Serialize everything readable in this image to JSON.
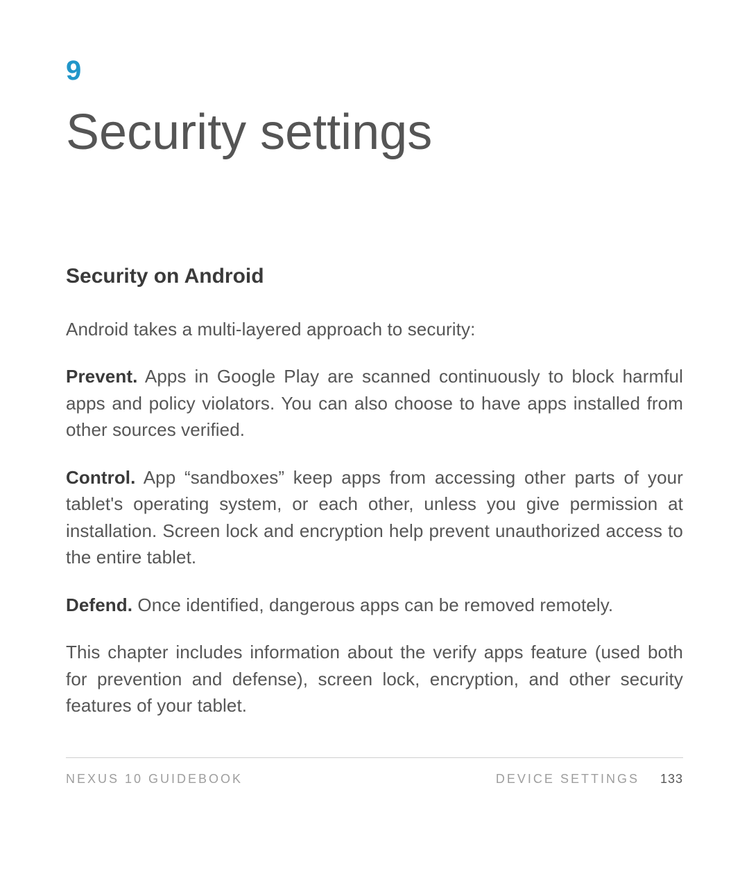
{
  "chapter": {
    "number": "9",
    "title": "Security settings"
  },
  "section": {
    "heading": "Security on Android",
    "intro": "Android takes a multi-layered approach to security:",
    "paragraphs": [
      {
        "lead": "Prevent.",
        "text": " Apps in Google Play are scanned continuously to block harmful apps and policy violators. You can also choose to have apps installed from other sources verified."
      },
      {
        "lead": "Control.",
        "text": " App “sandboxes” keep apps from accessing other parts of your tablet's operating system, or each other, unless you give permission at installation. Screen lock and encryption help prevent unauthorized access to the entire tablet."
      },
      {
        "lead": "Defend.",
        "text": " Once identified, dangerous apps can be removed remotely."
      }
    ],
    "closing": "This chapter includes information about the verify apps feature (used both for prevention and defense), screen lock, encryption, and other security features of your tablet."
  },
  "footer": {
    "left": "NEXUS 10 GUIDEBOOK",
    "rightLabel": "DEVICE SETTINGS",
    "pageNumber": "133"
  }
}
